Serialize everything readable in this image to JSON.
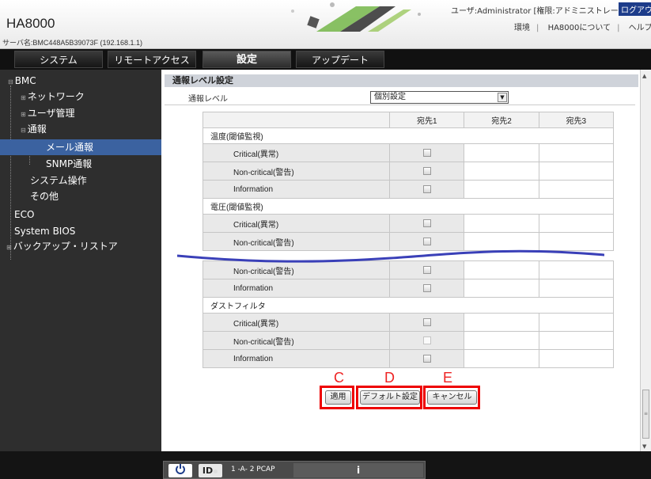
{
  "app": {
    "title": "HA8000",
    "server_name": "サーバ名:BMC448A5B39073F (192.168.1.1)"
  },
  "header": {
    "user_info": "ユーザ:Administrator [権限:アドミニストレータ]",
    "logout": "ログアウト",
    "links": [
      "環境",
      "HA8000について",
      "ヘルプ"
    ]
  },
  "tabs": [
    {
      "label": "システム"
    },
    {
      "label": "リモートアクセス"
    },
    {
      "label": "設定",
      "active": true
    },
    {
      "label": "アップデート"
    }
  ],
  "sidebar": {
    "items": [
      {
        "label": "BMC",
        "expander": "⊟"
      },
      {
        "label": "ネットワーク",
        "expander": "⊞"
      },
      {
        "label": "ユーザ管理",
        "expander": "⊞"
      },
      {
        "label": "通報",
        "expander": "⊟"
      },
      {
        "label": "メール通報",
        "selected": true
      },
      {
        "label": "SNMP通報"
      },
      {
        "label": "システム操作"
      },
      {
        "label": "その他"
      },
      {
        "label": "ECO"
      },
      {
        "label": "System BIOS"
      },
      {
        "label": "バックアップ・リストア",
        "expander": "⊞"
      }
    ]
  },
  "main": {
    "section_title": "通報レベル設定",
    "level_label": "通報レベル",
    "level_value": "個別設定",
    "columns": [
      "",
      "宛先1",
      "宛先2",
      "宛先3"
    ],
    "groups_top": [
      {
        "name": "温度(閾値監視)",
        "rows": [
          "Critical(異常)",
          "Non-critical(警告)",
          "Information"
        ]
      },
      {
        "name": "電圧(閾値監視)",
        "rows": [
          "Critical(異常)",
          "Non-critical(警告)"
        ]
      }
    ],
    "groups_bottom": [
      {
        "rows": [
          "Non-critical(警告)",
          "Information"
        ]
      },
      {
        "name": "ダストフィルタ",
        "rows": [
          "Critical(異常)",
          "Non-critical(警告)",
          "Information"
        ]
      }
    ],
    "annotation_labels": [
      "C",
      "D",
      "E"
    ],
    "buttons": {
      "apply": "適用",
      "default": "デフォルト設定",
      "cancel": "キャンセル"
    },
    "accent_color": "#e00000"
  },
  "footer": {
    "power_icon": "power-icon",
    "id_label": "ID",
    "status_text": "1 -A- 2  PCAP",
    "info": "i"
  }
}
